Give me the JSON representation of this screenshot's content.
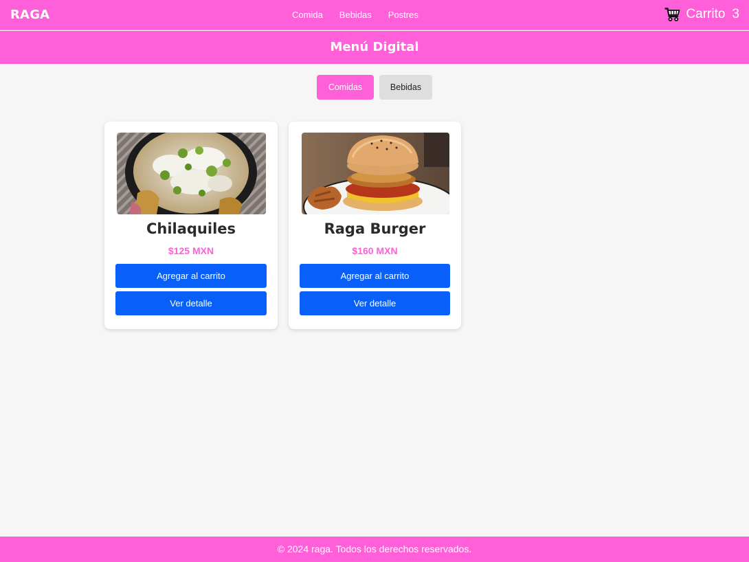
{
  "navbar": {
    "brand": "RAGA",
    "links": [
      "Comida",
      "Bebidas",
      "Postres"
    ],
    "cart_label": "Carrito",
    "cart_count": "3",
    "cart_icon": "cart-icon"
  },
  "header": {
    "title": "Menú Digital"
  },
  "filters": [
    {
      "label": "Comidas",
      "active": true
    },
    {
      "label": "Bebidas",
      "active": false
    }
  ],
  "products": [
    {
      "name": "Chilaquiles",
      "price": "$125 MXN",
      "add_label": "Agregar al carrito",
      "detail_label": "Ver detalle"
    },
    {
      "name": "Raga Burger",
      "price": "$160 MXN",
      "add_label": "Agregar al carrito",
      "detail_label": "Ver detalle"
    }
  ],
  "footer": {
    "text": "© 2024 raga. Todos los derechos reservados."
  },
  "colors": {
    "accent": "#ff5fd9",
    "button": "#0860f9",
    "background": "#f6f6f6"
  }
}
